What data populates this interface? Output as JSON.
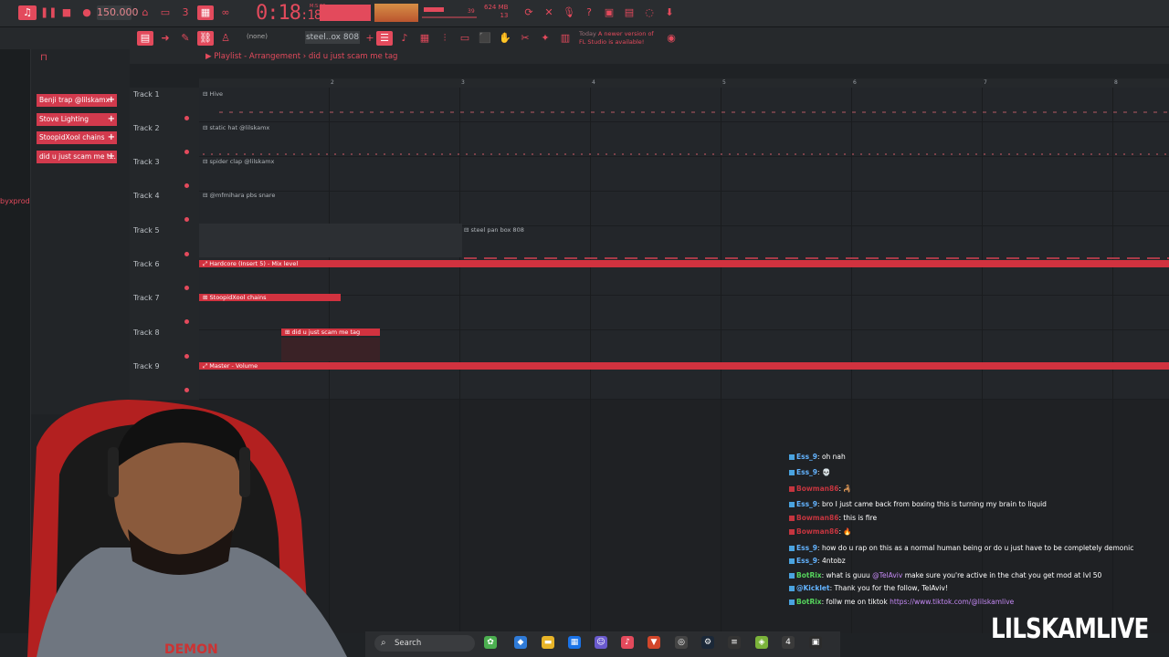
{
  "transport": {
    "tempo": "150.000",
    "song_time": "0:18",
    "song_time_ms": "18",
    "time_sub": "M:S:CS",
    "cpu": "39",
    "memory": "624 MB",
    "poly": "13"
  },
  "toolbar": {
    "pattern_name": "steel..ox 808",
    "pattern_none": "(none)",
    "news_line1": "Today",
    "news_line1b": "A newer version of",
    "news_line2": "FL Studio is available!"
  },
  "left": {
    "byxprod": "byxprod"
  },
  "picker": {
    "clips": [
      "Benji trap @lilskamx",
      "Stove Lighting",
      "StoopidXool chains",
      "did u just scam me t..."
    ]
  },
  "playlist": {
    "title": "Playlist - Arrangement",
    "arrangement": "did u just scam me tag",
    "ruler": [
      "2",
      "3",
      "4",
      "5",
      "6",
      "7",
      "8"
    ],
    "tracks": [
      "Track 1",
      "Track 2",
      "Track 3",
      "Track 4",
      "Track 5",
      "Track 6",
      "Track 7",
      "Track 8",
      "Track 9"
    ],
    "lanes": {
      "t1": "Hive",
      "t2": "static hat @lilskamx",
      "t3": "spider clap @lilskamx",
      "t4": "@mfmihara pbs snare",
      "t5": "steel pan box 808",
      "t6": "Hardcore (Insert 5) - Mix level",
      "t7": "StoopidXool chains",
      "t8": "did u just scam me tag",
      "t9": "Master - Volume"
    }
  },
  "chat": [
    {
      "user": "Ess_9",
      "msg": ": oh nah"
    },
    {
      "user": "Ess_9",
      "msg": ": 💀"
    },
    {
      "user": "Bowman86",
      "msg": ": 🦂"
    },
    {
      "user": "Ess_9",
      "msg": ": bro I just came back from boxing this is turning my brain to liquid"
    },
    {
      "user": "Bowman86",
      "msg": ": this is fire"
    },
    {
      "user": "Bowman86",
      "msg": ": 🔥"
    },
    {
      "user": "Ess_9",
      "msg": ": how do u rap on this as a normal human being or do u just have to be completely demonic"
    },
    {
      "user": "Ess_9",
      "msg": ": 4ntobz"
    },
    {
      "user": "BotRix",
      "msg": ": what is guuu",
      "mention": "@TelAviv",
      "msg2": " make sure you're active in the chat you get mod at lvl 50"
    },
    {
      "user": "@Kicklet",
      "msg": ": Thank you for the follow, TelAviv!"
    },
    {
      "user": "BotRix",
      "msg": ": follw me on tiktok ",
      "link": "https://www.tiktok.com/@lilskamlive"
    }
  ],
  "taskbar": {
    "search": "Search"
  },
  "watermark": "LILSKAMLIVE",
  "colors": {
    "accent": "#e34a5c",
    "track_red": "#d1323f",
    "bg": "#1f2225"
  }
}
